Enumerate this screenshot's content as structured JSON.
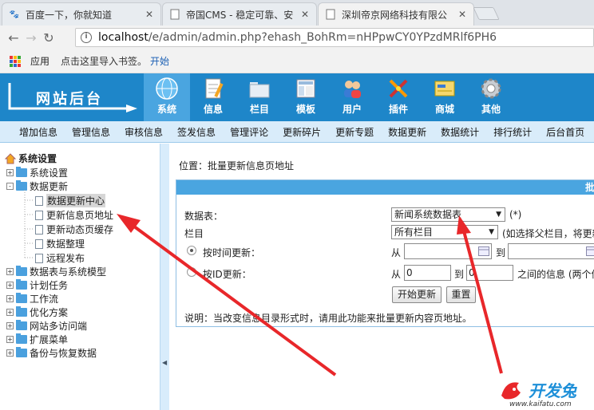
{
  "browser": {
    "tabs": [
      {
        "title": "百度一下，你就知道",
        "active": false
      },
      {
        "title": "帝国CMS - 稳定可靠、安",
        "active": false
      },
      {
        "title": "深圳帝京网络科技有限公",
        "active": true
      }
    ],
    "url_host": "localhost",
    "url_path": "/e/admin/admin.php?ehash_BohRm=nHPpwCY0YPzdMRlf6PH6",
    "bookmarks": {
      "apps_label": "应用",
      "hint": "点击这里导入书签。",
      "start_link": "开始"
    }
  },
  "header": {
    "logo_text": "网站后台",
    "menu": [
      {
        "label": "系统",
        "icon": "globe-icon",
        "selected": true
      },
      {
        "label": "信息",
        "icon": "notepad-icon",
        "selected": false
      },
      {
        "label": "栏目",
        "icon": "folder-icon",
        "selected": false
      },
      {
        "label": "模板",
        "icon": "template-icon",
        "selected": false
      },
      {
        "label": "用户",
        "icon": "users-icon",
        "selected": false
      },
      {
        "label": "插件",
        "icon": "plugin-icon",
        "selected": false
      },
      {
        "label": "商城",
        "icon": "mall-icon",
        "selected": false
      },
      {
        "label": "其他",
        "icon": "gear-icon",
        "selected": false
      }
    ]
  },
  "subnav": [
    "增加信息",
    "管理信息",
    "审核信息",
    "签发信息",
    "管理评论",
    "更新碎片",
    "更新专题",
    "数据更新",
    "数据统计",
    "排行统计",
    "后台首页"
  ],
  "sidebar": {
    "root": "系统设置",
    "items": [
      {
        "label": "系统设置",
        "type": "folder",
        "expand": "+"
      },
      {
        "label": "数据更新",
        "type": "folder",
        "expand": "-"
      },
      {
        "label": "数据更新中心",
        "type": "doc"
      },
      {
        "label": "更新信息页地址",
        "type": "doc"
      },
      {
        "label": "更新动态页缓存",
        "type": "doc"
      },
      {
        "label": "数据整理",
        "type": "doc"
      },
      {
        "label": "远程发布",
        "type": "doc"
      },
      {
        "label": "数据表与系统模型",
        "type": "folder",
        "expand": "+"
      },
      {
        "label": "计划任务",
        "type": "folder",
        "expand": "+"
      },
      {
        "label": "工作流",
        "type": "folder",
        "expand": "+"
      },
      {
        "label": "优化方案",
        "type": "folder",
        "expand": "+"
      },
      {
        "label": "网站多访问端",
        "type": "folder",
        "expand": "+"
      },
      {
        "label": "扩展菜单",
        "type": "folder",
        "expand": "+"
      },
      {
        "label": "备份与恢复数据",
        "type": "folder",
        "expand": "+"
      }
    ]
  },
  "main": {
    "breadcrumb": "位置：批量更新信息页地址",
    "panel_title": "批",
    "table_label": "数据表：",
    "table_value": "新闻系统数据表",
    "table_note": "(*)",
    "column_label": "栏目",
    "column_value": "所有栏目",
    "column_note": "(如选择父栏目，将更新",
    "time_update_label": "按时间更新：",
    "from_label": "从",
    "to_label": "到",
    "id_update_label": "按ID更新：",
    "id_from_label": "从",
    "id_from_value": "0",
    "id_to_label": "到",
    "id_to_value": "0",
    "id_note": "之间的信息 (两个值",
    "start_button": "开始更新",
    "reset_button": "重置",
    "description": "说明：当改变信息目录形式时，请用此功能来批量更新内容页地址。"
  },
  "watermark": {
    "text": "开发兔",
    "url": "www.kaifatu.com"
  },
  "colors": {
    "header_blue": "#1e86c9",
    "subnav_bg": "#d9ecfa",
    "annotation_red": "#e8272a"
  }
}
